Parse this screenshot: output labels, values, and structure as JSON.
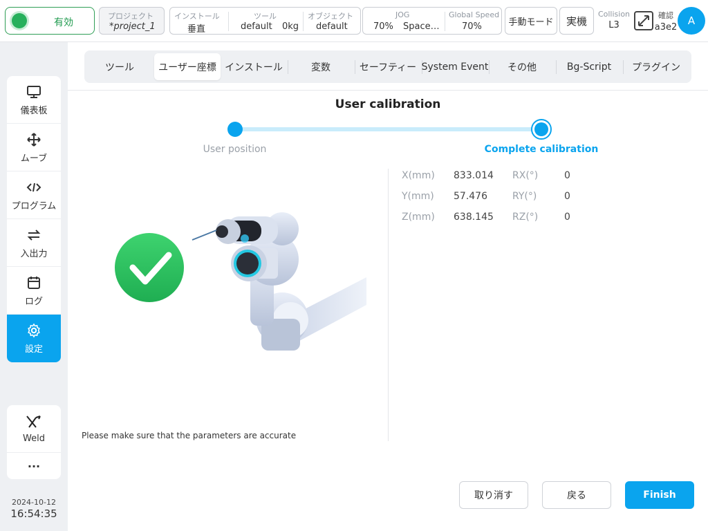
{
  "header": {
    "enable_label": "有効",
    "project_label": "プロジェクト",
    "project_value": "*project_1",
    "install_label": "インストール",
    "install_value": "垂直",
    "tool_label": "ツール",
    "tool_value": "default",
    "tool_weight": "0kg",
    "object_label": "オブジェクト",
    "object_value": "default",
    "jog_label": "JOG",
    "jog_value": "70%",
    "jog_space": "Space…",
    "speed_label": "Global Speed",
    "speed_value": "70%",
    "mode_button": "手動モード",
    "real_button": "実機",
    "collision_label": "Collision",
    "collision_value": "L3",
    "confirm_label": "確認",
    "confirm_value": "a3e2",
    "avatar_letter": "A"
  },
  "sidebar": {
    "items": [
      {
        "label": "儀表板",
        "icon": "monitor-icon"
      },
      {
        "label": "ムーブ",
        "icon": "move-arrows-icon"
      },
      {
        "label": "プログラム",
        "icon": "code-icon"
      },
      {
        "label": "入出力",
        "icon": "swap-icon"
      },
      {
        "label": "ログ",
        "icon": "calendar-icon"
      },
      {
        "label": "設定",
        "icon": "gear-icon",
        "active": true
      }
    ],
    "weld_label": "Weld",
    "more_label": "···",
    "date": "2024-10-12",
    "time": "16:54:35"
  },
  "tabs": [
    "ツール",
    "ユーザー座標",
    "インストール",
    "変数",
    "セーフティー",
    "System Event",
    "その他",
    "Bg-Script",
    "プラグイン"
  ],
  "active_tab": "ユーザー座標",
  "calibration": {
    "title": "User calibration",
    "step1": "User position",
    "step2": "Complete calibration",
    "note": "Please make sure that the parameters are accurate",
    "coords": [
      {
        "k1": "X(mm)",
        "v1": "833.014",
        "k2": "RX(°)",
        "v2": "0"
      },
      {
        "k1": "Y(mm)",
        "v1": "57.476",
        "k2": "RY(°)",
        "v2": "0"
      },
      {
        "k1": "Z(mm)",
        "v1": "638.145",
        "k2": "RZ(°)",
        "v2": "0"
      }
    ]
  },
  "buttons": {
    "cancel": "取り消す",
    "back": "戻る",
    "finish": "Finish"
  },
  "colors": {
    "accent": "#0aa4ee",
    "success": "#27b05c"
  }
}
